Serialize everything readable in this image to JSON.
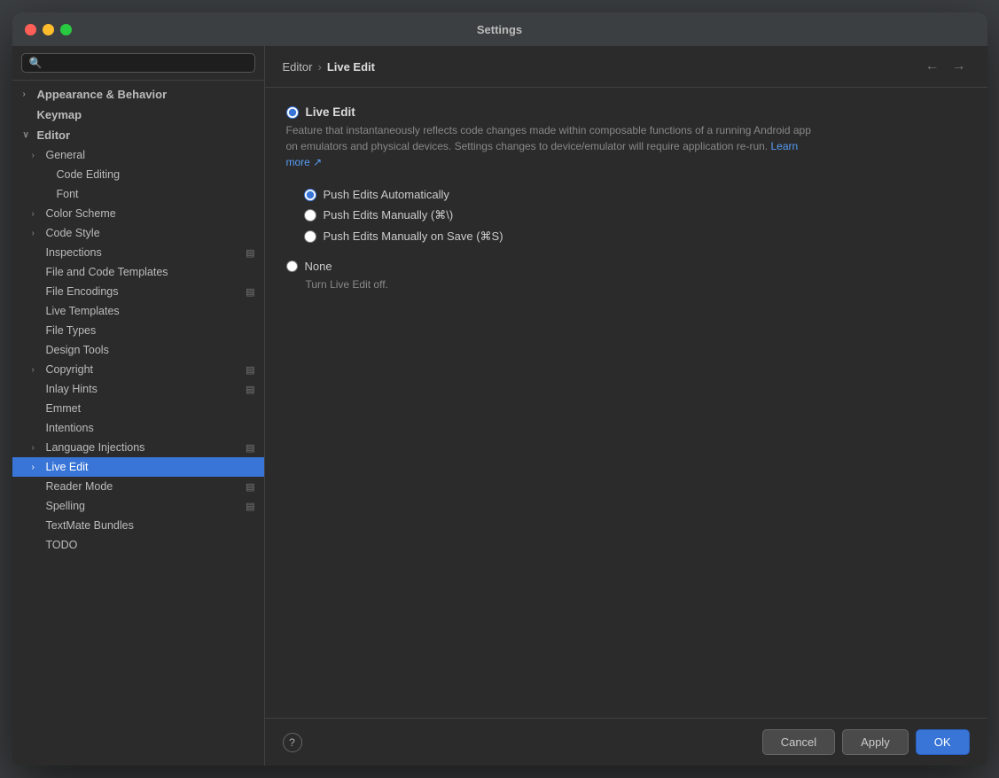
{
  "window": {
    "title": "Settings"
  },
  "breadcrumb": {
    "parent": "Editor",
    "separator": "›",
    "current": "Live Edit"
  },
  "sidebar": {
    "search_placeholder": "🔍",
    "items": [
      {
        "id": "appearance",
        "label": "Appearance & Behavior",
        "level": 0,
        "has_chevron": true,
        "chevron": "›",
        "active": false,
        "badge": false
      },
      {
        "id": "keymap",
        "label": "Keymap",
        "level": 0,
        "has_chevron": false,
        "active": false,
        "badge": false
      },
      {
        "id": "editor",
        "label": "Editor",
        "level": 0,
        "has_chevron": true,
        "chevron": "∨",
        "active": false,
        "badge": false,
        "expanded": true
      },
      {
        "id": "general",
        "label": "General",
        "level": 1,
        "has_chevron": true,
        "chevron": "›",
        "active": false,
        "badge": false
      },
      {
        "id": "code-editing",
        "label": "Code Editing",
        "level": 2,
        "has_chevron": false,
        "active": false,
        "badge": false
      },
      {
        "id": "font",
        "label": "Font",
        "level": 2,
        "has_chevron": false,
        "active": false,
        "badge": false
      },
      {
        "id": "color-scheme",
        "label": "Color Scheme",
        "level": 1,
        "has_chevron": true,
        "chevron": "›",
        "active": false,
        "badge": false
      },
      {
        "id": "code-style",
        "label": "Code Style",
        "level": 1,
        "has_chevron": true,
        "chevron": "›",
        "active": false,
        "badge": false
      },
      {
        "id": "inspections",
        "label": "Inspections",
        "level": 1,
        "has_chevron": false,
        "active": false,
        "badge": true
      },
      {
        "id": "file-code-templates",
        "label": "File and Code Templates",
        "level": 1,
        "has_chevron": false,
        "active": false,
        "badge": false
      },
      {
        "id": "file-encodings",
        "label": "File Encodings",
        "level": 1,
        "has_chevron": false,
        "active": false,
        "badge": true
      },
      {
        "id": "live-templates",
        "label": "Live Templates",
        "level": 1,
        "has_chevron": false,
        "active": false,
        "badge": false
      },
      {
        "id": "file-types",
        "label": "File Types",
        "level": 1,
        "has_chevron": false,
        "active": false,
        "badge": false
      },
      {
        "id": "design-tools",
        "label": "Design Tools",
        "level": 1,
        "has_chevron": false,
        "active": false,
        "badge": false
      },
      {
        "id": "copyright",
        "label": "Copyright",
        "level": 1,
        "has_chevron": true,
        "chevron": "›",
        "active": false,
        "badge": true
      },
      {
        "id": "inlay-hints",
        "label": "Inlay Hints",
        "level": 1,
        "has_chevron": false,
        "active": false,
        "badge": true
      },
      {
        "id": "emmet",
        "label": "Emmet",
        "level": 1,
        "has_chevron": false,
        "active": false,
        "badge": false
      },
      {
        "id": "intentions",
        "label": "Intentions",
        "level": 1,
        "has_chevron": false,
        "active": false,
        "badge": false
      },
      {
        "id": "language-injections",
        "label": "Language Injections",
        "level": 1,
        "has_chevron": true,
        "chevron": "›",
        "active": false,
        "badge": true
      },
      {
        "id": "live-edit",
        "label": "Live Edit",
        "level": 1,
        "has_chevron": true,
        "chevron": "›",
        "active": true,
        "badge": false
      },
      {
        "id": "reader-mode",
        "label": "Reader Mode",
        "level": 1,
        "has_chevron": false,
        "active": false,
        "badge": true
      },
      {
        "id": "spelling",
        "label": "Spelling",
        "level": 1,
        "has_chevron": false,
        "active": false,
        "badge": true
      },
      {
        "id": "textmate-bundles",
        "label": "TextMate Bundles",
        "level": 1,
        "has_chevron": false,
        "active": false,
        "badge": false
      },
      {
        "id": "todo",
        "label": "TODO",
        "level": 1,
        "has_chevron": false,
        "active": false,
        "badge": false
      }
    ]
  },
  "main": {
    "section_title": "Live Edit",
    "description": "Feature that instantaneously reflects code changes made within composable functions of a running Android app on emulators and physical devices. Settings changes to device/emulator will require application re-run.",
    "learn_more": "Learn more ↗",
    "radio_options": [
      {
        "id": "push-auto",
        "label": "Push Edits Automatically",
        "checked": true
      },
      {
        "id": "push-manually",
        "label": "Push Edits Manually (⌘\\)",
        "checked": false
      },
      {
        "id": "push-save",
        "label": "Push Edits Manually on Save (⌘S)",
        "checked": false
      }
    ],
    "none_label": "None",
    "none_desc": "Turn Live Edit off."
  },
  "footer": {
    "help_label": "?",
    "cancel_label": "Cancel",
    "apply_label": "Apply",
    "ok_label": "OK"
  }
}
